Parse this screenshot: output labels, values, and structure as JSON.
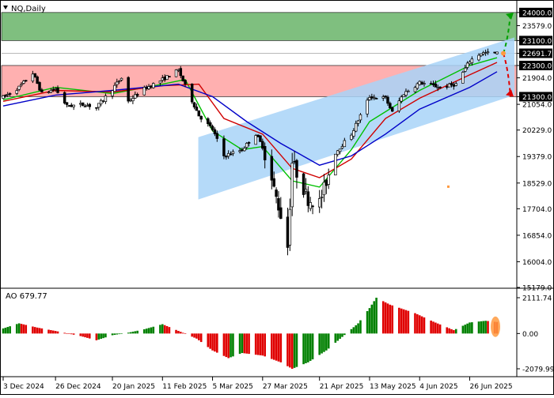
{
  "symbol_label": "NQ,Daily",
  "colors": {
    "bull_candle": "#ffffff",
    "bear_candle": "#000000",
    "ma_fast": "#00c000",
    "ma_mid": "#d00000",
    "ma_slow": "#0000c8",
    "resistance_zone": "#7fbf7f",
    "support_zone": "#ffb0b0",
    "channel": "#a8d4f8",
    "ao_up": "#008000",
    "ao_down": "#e00000",
    "forecast_up": "#00a000",
    "forecast_down": "#e00000",
    "forecast_dot": "#ff9a40"
  },
  "chart_data": [
    {
      "type": "candlestick",
      "symbol": "NQ",
      "timeframe": "Daily",
      "ylim": [
        15179.0,
        24300.0
      ],
      "y_ticks": [
        24000.0,
        23579.0,
        23100.0,
        22691.7,
        22300.0,
        21904.0,
        21300.0,
        21054.0,
        20229.0,
        19379.0,
        18529.0,
        17704.0,
        16854.0,
        16004.0,
        15179.0
      ],
      "highlighted_levels": [
        {
          "label": "24000.0",
          "value": 24000.0
        },
        {
          "label": "23100.0",
          "value": 23100.0
        },
        {
          "label": "22691.7",
          "value": 22691.7
        },
        {
          "label": "22300.0",
          "value": 22300.0
        },
        {
          "label": "21300.0",
          "value": 21300.0
        }
      ],
      "x_tick_labels": [
        "3 Dec 2024",
        "26 Dec 2024",
        "20 Jan 2025",
        "11 Feb 2025",
        "5 Mar 2025",
        "27 Mar 2025",
        "21 Apr 2025",
        "13 May 2025",
        "4 Jun 2025",
        "26 Jun 2025"
      ],
      "zones": [
        {
          "name": "resistance",
          "from": 23100.0,
          "to": 24000.0
        },
        {
          "name": "support",
          "from": 21300.0,
          "to": 22300.0
        }
      ],
      "close_path": [
        {
          "date": "2024-12-03",
          "close": 21280
        },
        {
          "date": "2024-12-10",
          "close": 21600
        },
        {
          "date": "2024-12-16",
          "close": 22050
        },
        {
          "date": "2024-12-20",
          "close": 21400
        },
        {
          "date": "2024-12-26",
          "close": 21550
        },
        {
          "date": "2024-12-31",
          "close": 21000
        },
        {
          "date": "2025-01-08",
          "close": 21050
        },
        {
          "date": "2025-01-13",
          "close": 20950
        },
        {
          "date": "2025-01-20",
          "close": 21550
        },
        {
          "date": "2025-01-24",
          "close": 21900
        },
        {
          "date": "2025-01-27",
          "close": 21150
        },
        {
          "date": "2025-02-03",
          "close": 21550
        },
        {
          "date": "2025-02-11",
          "close": 21850
        },
        {
          "date": "2025-02-18",
          "close": 22150
        },
        {
          "date": "2025-02-21",
          "close": 21650
        },
        {
          "date": "2025-02-27",
          "close": 20700
        },
        {
          "date": "2025-03-05",
          "close": 20250
        },
        {
          "date": "2025-03-10",
          "close": 19400
        },
        {
          "date": "2025-03-18",
          "close": 19600
        },
        {
          "date": "2025-03-24",
          "close": 20100
        },
        {
          "date": "2025-03-27",
          "close": 19700
        },
        {
          "date": "2025-04-04",
          "close": 17500
        },
        {
          "date": "2025-04-07",
          "close": 16500
        },
        {
          "date": "2025-04-09",
          "close": 19200
        },
        {
          "date": "2025-04-16",
          "close": 18000
        },
        {
          "date": "2025-04-21",
          "close": 17900
        },
        {
          "date": "2025-04-28",
          "close": 19500
        },
        {
          "date": "2025-05-05",
          "close": 20100
        },
        {
          "date": "2025-05-13",
          "close": 21300
        },
        {
          "date": "2025-05-20",
          "close": 21250
        },
        {
          "date": "2025-05-23",
          "close": 20800
        },
        {
          "date": "2025-05-28",
          "close": 21400
        },
        {
          "date": "2025-06-04",
          "close": 21750
        },
        {
          "date": "2025-06-13",
          "close": 21600
        },
        {
          "date": "2025-06-20",
          "close": 21700
        },
        {
          "date": "2025-06-26",
          "close": 22450
        },
        {
          "date": "2025-07-01",
          "close": 22700
        },
        {
          "date": "2025-07-08",
          "close": 22691.7
        }
      ],
      "series": [
        {
          "values": [
            {
              "date": "2024-12-03",
              "y": 21200
            },
            {
              "date": "2024-12-26",
              "y": 21600
            },
            {
              "date": "2025-01-20",
              "y": 21400
            },
            {
              "date": "2025-02-11",
              "y": 21700
            },
            {
              "date": "2025-02-21",
              "y": 21850
            },
            {
              "date": "2025-03-05",
              "y": 20200
            },
            {
              "date": "2025-03-18",
              "y": 19600
            },
            {
              "date": "2025-03-27",
              "y": 19700
            },
            {
              "date": "2025-04-09",
              "y": 18600
            },
            {
              "date": "2025-04-21",
              "y": 18400
            },
            {
              "date": "2025-05-05",
              "y": 19600
            },
            {
              "date": "2025-05-13",
              "y": 20500
            },
            {
              "date": "2025-06-04",
              "y": 21500
            },
            {
              "date": "2025-06-26",
              "y": 22300
            },
            {
              "date": "2025-07-08",
              "y": 22550
            }
          ]
        },
        {
          "values": [
            {
              "date": "2024-12-03",
              "y": 21150
            },
            {
              "date": "2024-12-26",
              "y": 21500
            },
            {
              "date": "2025-01-20",
              "y": 21450
            },
            {
              "date": "2025-02-11",
              "y": 21650
            },
            {
              "date": "2025-02-27",
              "y": 21700
            },
            {
              "date": "2025-03-10",
              "y": 20600
            },
            {
              "date": "2025-03-27",
              "y": 20100
            },
            {
              "date": "2025-04-09",
              "y": 19000
            },
            {
              "date": "2025-04-21",
              "y": 18700
            },
            {
              "date": "2025-05-05",
              "y": 19300
            },
            {
              "date": "2025-05-20",
              "y": 20600
            },
            {
              "date": "2025-06-04",
              "y": 21250
            },
            {
              "date": "2025-06-26",
              "y": 22000
            },
            {
              "date": "2025-07-08",
              "y": 22400
            }
          ]
        },
        {
          "values": [
            {
              "date": "2024-12-03",
              "y": 21000
            },
            {
              "date": "2024-12-26",
              "y": 21350
            },
            {
              "date": "2025-01-20",
              "y": 21500
            },
            {
              "date": "2025-02-18",
              "y": 21700
            },
            {
              "date": "2025-03-05",
              "y": 21300
            },
            {
              "date": "2025-03-20",
              "y": 20500
            },
            {
              "date": "2025-04-04",
              "y": 19800
            },
            {
              "date": "2025-04-21",
              "y": 19100
            },
            {
              "date": "2025-05-05",
              "y": 19400
            },
            {
              "date": "2025-05-20",
              "y": 20100
            },
            {
              "date": "2025-06-04",
              "y": 20900
            },
            {
              "date": "2025-06-26",
              "y": 21600
            },
            {
              "date": "2025-07-08",
              "y": 22100
            }
          ]
        }
      ],
      "channel": [
        {
          "date": "2025-03-05",
          "upper": 20000,
          "lower": 18000
        },
        {
          "date": "2025-07-08",
          "upper": 23200,
          "lower": 21350
        }
      ],
      "forecast": [
        {
          "direction": "up",
          "from": 22691.7,
          "to": 24000.0
        },
        {
          "direction": "down",
          "from": 22691.7,
          "to": 21300.0
        }
      ]
    },
    {
      "type": "bar",
      "indicator": "AO",
      "title": "AO 679.77",
      "ylim": [
        -2079.99,
        2111.74
      ],
      "y_ticks": [
        2111.74,
        0.0,
        -2079.99
      ],
      "y_tick_labels": [
        "2111.74",
        "0.00",
        "-2079.99"
      ],
      "ao_path": [
        {
          "date": "2024-12-03",
          "value": 300
        },
        {
          "date": "2024-12-10",
          "value": 600
        },
        {
          "date": "2024-12-18",
          "value": 350
        },
        {
          "date": "2024-12-26",
          "value": 150
        },
        {
          "date": "2025-01-06",
          "value": -150
        },
        {
          "date": "2025-01-13",
          "value": -400
        },
        {
          "date": "2025-01-20",
          "value": -100
        },
        {
          "date": "2025-01-27",
          "value": 50
        },
        {
          "date": "2025-02-03",
          "value": 250
        },
        {
          "date": "2025-02-11",
          "value": 550
        },
        {
          "date": "2025-02-19",
          "value": 100
        },
        {
          "date": "2025-02-26",
          "value": -300
        },
        {
          "date": "2025-03-05",
          "value": -1000
        },
        {
          "date": "2025-03-12",
          "value": -1450
        },
        {
          "date": "2025-03-18",
          "value": -1150
        },
        {
          "date": "2025-03-27",
          "value": -1300
        },
        {
          "date": "2025-04-04",
          "value": -1700
        },
        {
          "date": "2025-04-09",
          "value": -2079.99
        },
        {
          "date": "2025-04-16",
          "value": -1700
        },
        {
          "date": "2025-04-24",
          "value": -1000
        },
        {
          "date": "2025-05-01",
          "value": -200
        },
        {
          "date": "2025-05-08",
          "value": 600
        },
        {
          "date": "2025-05-13",
          "value": 1500
        },
        {
          "date": "2025-05-16",
          "value": 2111.74
        },
        {
          "date": "2025-05-22",
          "value": 1700
        },
        {
          "date": "2025-06-02",
          "value": 1200
        },
        {
          "date": "2025-06-10",
          "value": 700
        },
        {
          "date": "2025-06-19",
          "value": 200
        },
        {
          "date": "2025-06-26",
          "value": 650
        },
        {
          "date": "2025-07-03",
          "value": 750
        },
        {
          "date": "2025-07-08",
          "value": 679.77
        }
      ]
    }
  ]
}
